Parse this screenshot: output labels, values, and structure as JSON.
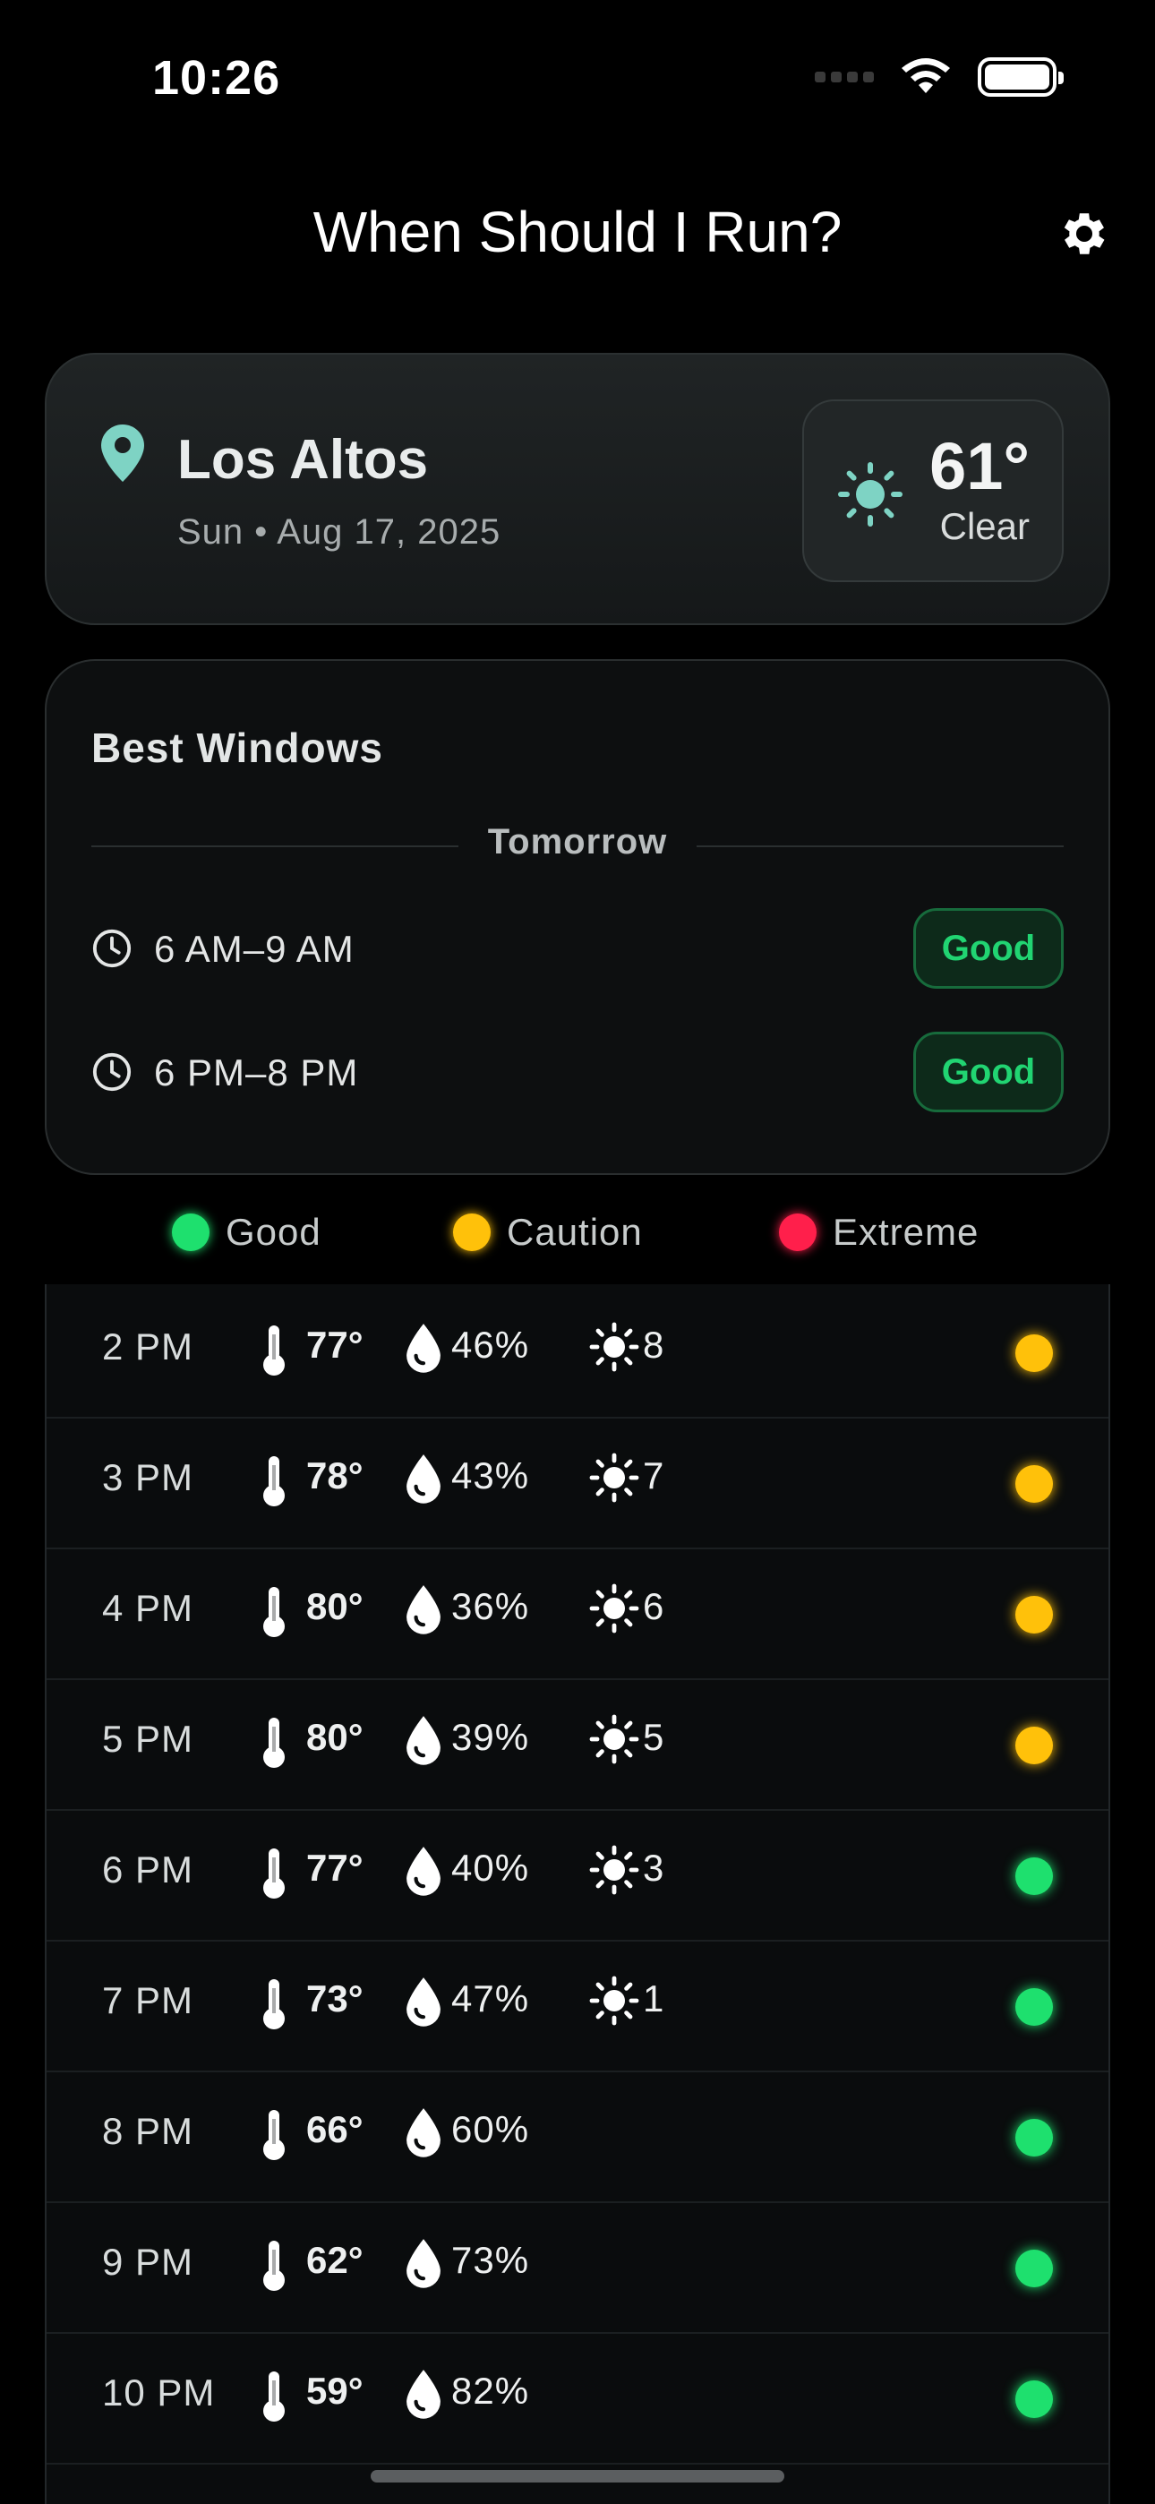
{
  "status_bar": {
    "time": "10:26"
  },
  "header": {
    "title": "When Should I Run?",
    "settings_icon": "gear-icon"
  },
  "location": {
    "name": "Los Altos",
    "date": "Sun • Aug 17, 2025",
    "temperature": "61°",
    "condition": "Clear",
    "weather_icon": "sun-icon",
    "accent_color": "#7ed3c4"
  },
  "best_windows": {
    "title": "Best Windows",
    "day_label": "Tomorrow",
    "windows": [
      {
        "time": "6 AM–9 AM",
        "rating": "Good"
      },
      {
        "time": "6 PM–8 PM",
        "rating": "Good"
      }
    ]
  },
  "legend": {
    "items": [
      {
        "label": "Good",
        "color": "#1ee06e"
      },
      {
        "label": "Caution",
        "color": "#ffc10a"
      },
      {
        "label": "Extreme",
        "color": "#ff1f4b"
      }
    ]
  },
  "hourly": [
    {
      "hour": "2 PM",
      "temp": "77°",
      "humidity": "46%",
      "uv": "8",
      "status": "caution"
    },
    {
      "hour": "3 PM",
      "temp": "78°",
      "humidity": "43%",
      "uv": "7",
      "status": "caution"
    },
    {
      "hour": "4 PM",
      "temp": "80°",
      "humidity": "36%",
      "uv": "6",
      "status": "caution"
    },
    {
      "hour": "5 PM",
      "temp": "80°",
      "humidity": "39%",
      "uv": "5",
      "status": "caution"
    },
    {
      "hour": "6 PM",
      "temp": "77°",
      "humidity": "40%",
      "uv": "3",
      "status": "good"
    },
    {
      "hour": "7 PM",
      "temp": "73°",
      "humidity": "47%",
      "uv": "1",
      "status": "good"
    },
    {
      "hour": "8 PM",
      "temp": "66°",
      "humidity": "60%",
      "uv": "",
      "status": "good"
    },
    {
      "hour": "9 PM",
      "temp": "62°",
      "humidity": "73%",
      "uv": "",
      "status": "good"
    },
    {
      "hour": "10 PM",
      "temp": "59°",
      "humidity": "82%",
      "uv": "",
      "status": "good"
    }
  ],
  "status_colors": {
    "good": "#1ee06e",
    "caution": "#ffc10a",
    "extreme": "#ff1f4b"
  }
}
